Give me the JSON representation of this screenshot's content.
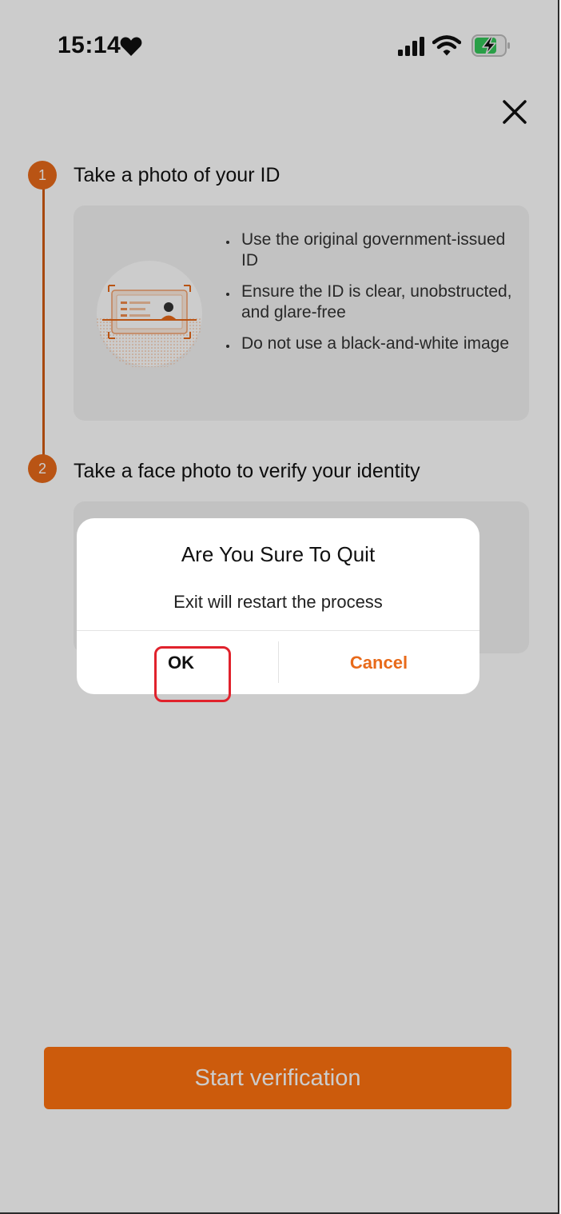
{
  "status_bar": {
    "time": "15:14",
    "icons": [
      "heart-icon",
      "signal-icon",
      "wifi-icon",
      "battery-charging-icon"
    ]
  },
  "header": {
    "close_icon": "close-icon"
  },
  "steps": [
    {
      "number": "1",
      "title": "Take a photo of your ID",
      "tips": [
        "Use the original government-issued ID",
        "Ensure the ID is clear, unobstructed, and glare-free",
        "Do not use a black-and-white image"
      ]
    },
    {
      "number": "2",
      "title": "Take a face photo to verify your identity"
    }
  ],
  "primary_button": {
    "label": "Start verification"
  },
  "dialog": {
    "title": "Are You Sure To Quit",
    "message": "Exit will restart the process",
    "ok_label": "OK",
    "cancel_label": "Cancel"
  },
  "colors": {
    "accent": "#e86a1a",
    "button": "#ff7210",
    "highlight": "#e0222c",
    "overlay": "rgba(0,0,0,0.2)"
  }
}
